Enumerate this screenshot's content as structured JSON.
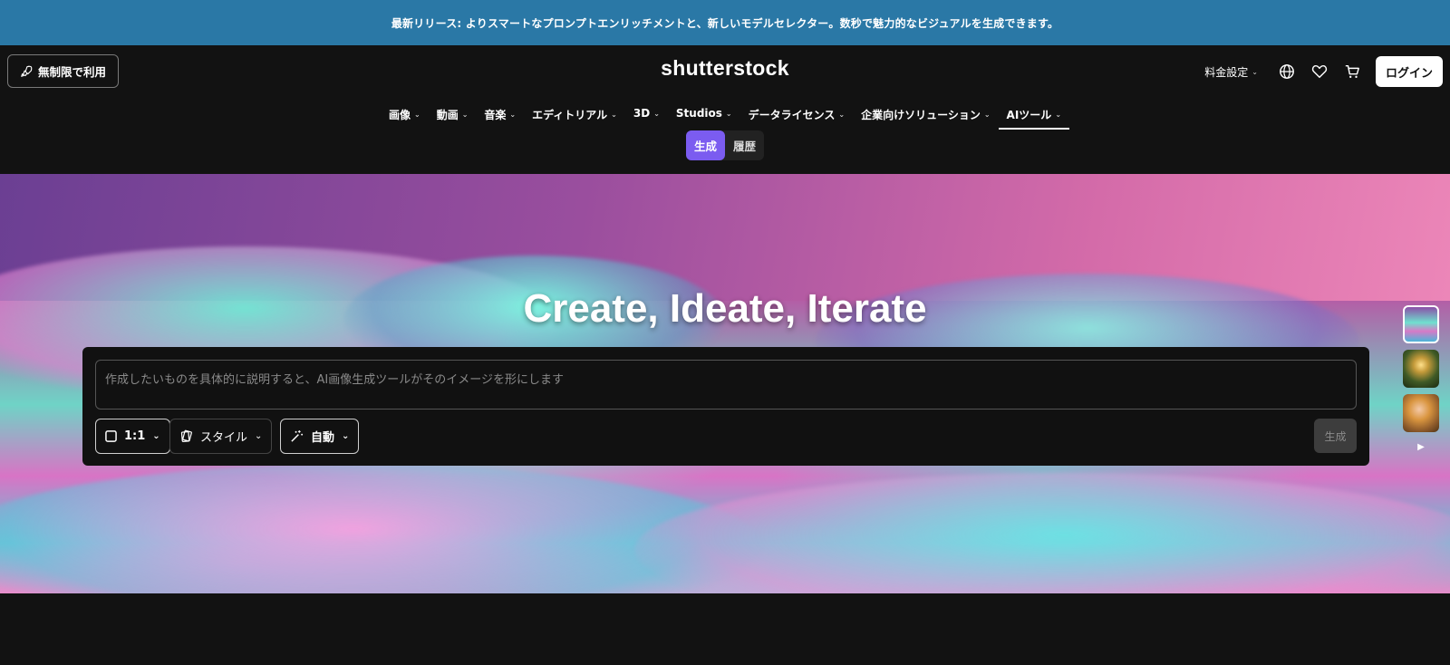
{
  "banner": {
    "text": "最新リリース: よりスマートなプロンプトエンリッチメントと、新しいモデルセレクター。数秒で魅力的なビジュアルを生成できます。"
  },
  "header": {
    "unlimited_label": "無制限で利用",
    "logo": "shutterstock",
    "pricing_label": "料金設定",
    "login_label": "ログイン"
  },
  "nav": {
    "items": [
      {
        "label": "画像"
      },
      {
        "label": "動画"
      },
      {
        "label": "音楽"
      },
      {
        "label": "エディトリアル"
      },
      {
        "label": "3D"
      },
      {
        "label": "Studios"
      },
      {
        "label": "データライセンス"
      },
      {
        "label": "企業向けソリューション"
      },
      {
        "label": "AIツール"
      }
    ],
    "active": "AIツール"
  },
  "subtabs": {
    "generate": "生成",
    "history": "履歴"
  },
  "hero": {
    "title": "Create, Ideate, Iterate"
  },
  "prompt": {
    "placeholder": "作成したいものを具体的に説明すると、AI画像生成ツールがそのイメージを形にします",
    "ratio_label": "1:1",
    "style_label": "スタイル",
    "auto_label": "自動",
    "generate_label": "生成"
  },
  "colors": {
    "banner": "#2a78a6",
    "accent": "#7b5cf0",
    "background": "#121212"
  }
}
